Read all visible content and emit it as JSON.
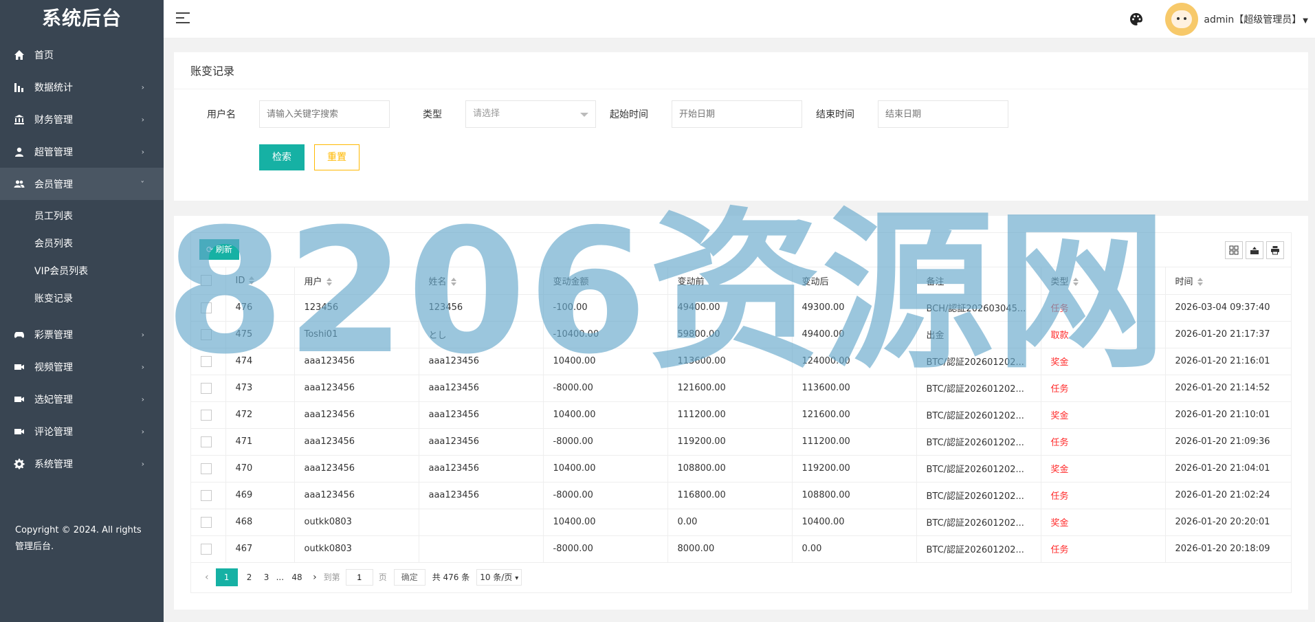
{
  "app": {
    "title": "系统后台"
  },
  "sidebar": {
    "items": [
      {
        "label": "首页",
        "icon": "home-icon"
      },
      {
        "label": "数据统计",
        "icon": "bar-chart-icon"
      },
      {
        "label": "财务管理",
        "icon": "bank-icon"
      },
      {
        "label": "超管管理",
        "icon": "user-icon"
      },
      {
        "label": "会员管理",
        "icon": "users-icon",
        "open": true,
        "children": [
          "员工列表",
          "会员列表",
          "VIP会员列表",
          "账变记录"
        ]
      },
      {
        "label": "彩票管理",
        "icon": "gamepad-icon"
      },
      {
        "label": "视频管理",
        "icon": "video-icon"
      },
      {
        "label": "选妃管理",
        "icon": "video-icon"
      },
      {
        "label": "评论管理",
        "icon": "video-icon"
      },
      {
        "label": "系统管理",
        "icon": "gear-icon"
      }
    ],
    "copyright": "Copyright © 2024. All rights 管理后台."
  },
  "header": {
    "user": "admin【超级管理员】"
  },
  "search": {
    "title": "账变记录",
    "username_label": "用户名",
    "username_placeholder": "请输入关键字搜索",
    "type_label": "类型",
    "type_placeholder": "请选择",
    "start_label": "起始时间",
    "start_placeholder": "开始日期",
    "end_label": "结束时间",
    "end_placeholder": "结束日期",
    "search_btn": "检索",
    "reset_btn": "重置"
  },
  "table": {
    "refresh_label": "刷新",
    "columns": [
      "ID",
      "用户",
      "姓名",
      "变动金额",
      "变动前",
      "变动后",
      "备注",
      "类型",
      "时间"
    ],
    "rows": [
      [
        "476",
        "123456",
        "123456",
        "-100.00",
        "49400.00",
        "49300.00",
        "BCH/認証202603045...",
        "任务",
        "2026-03-04 09:37:40"
      ],
      [
        "475",
        "Toshi01",
        "とし",
        "-10400.00",
        "59800.00",
        "49400.00",
        "出金",
        "取款",
        "2026-01-20 21:17:37"
      ],
      [
        "474",
        "aaa123456",
        "aaa123456",
        "10400.00",
        "113600.00",
        "124000.00",
        "BTC/認証202601202...",
        "奖金",
        "2026-01-20 21:16:01"
      ],
      [
        "473",
        "aaa123456",
        "aaa123456",
        "-8000.00",
        "121600.00",
        "113600.00",
        "BTC/認証202601202...",
        "任务",
        "2026-01-20 21:14:52"
      ],
      [
        "472",
        "aaa123456",
        "aaa123456",
        "10400.00",
        "111200.00",
        "121600.00",
        "BTC/認証202601202...",
        "奖金",
        "2026-01-20 21:10:01"
      ],
      [
        "471",
        "aaa123456",
        "aaa123456",
        "-8000.00",
        "119200.00",
        "111200.00",
        "BTC/認証202601202...",
        "任务",
        "2026-01-20 21:09:36"
      ],
      [
        "470",
        "aaa123456",
        "aaa123456",
        "10400.00",
        "108800.00",
        "119200.00",
        "BTC/認証202601202...",
        "奖金",
        "2026-01-20 21:04:01"
      ],
      [
        "469",
        "aaa123456",
        "aaa123456",
        "-8000.00",
        "116800.00",
        "108800.00",
        "BTC/認証202601202...",
        "任务",
        "2026-01-20 21:02:24"
      ],
      [
        "468",
        "outkk0803",
        "",
        "10400.00",
        "0.00",
        "10400.00",
        "BTC/認証202601202...",
        "奖金",
        "2026-01-20 20:20:01"
      ],
      [
        "467",
        "outkk0803",
        "",
        "-8000.00",
        "8000.00",
        "0.00",
        "BTC/認証202601202...",
        "任务",
        "2026-01-20 20:18:09"
      ]
    ]
  },
  "pager": {
    "pages": [
      "1",
      "2",
      "3",
      "...",
      "48"
    ],
    "goto_label": "到第",
    "goto_value": "1",
    "page_unit": "页",
    "confirm": "确定",
    "total": "共 476 条",
    "per_page": "10 条/页"
  },
  "watermark": "8206资源网",
  "colors": {
    "sidebar": "#394552",
    "primary": "#16b1a4",
    "warn": "#ffb800",
    "red": "#ff2a2a"
  }
}
